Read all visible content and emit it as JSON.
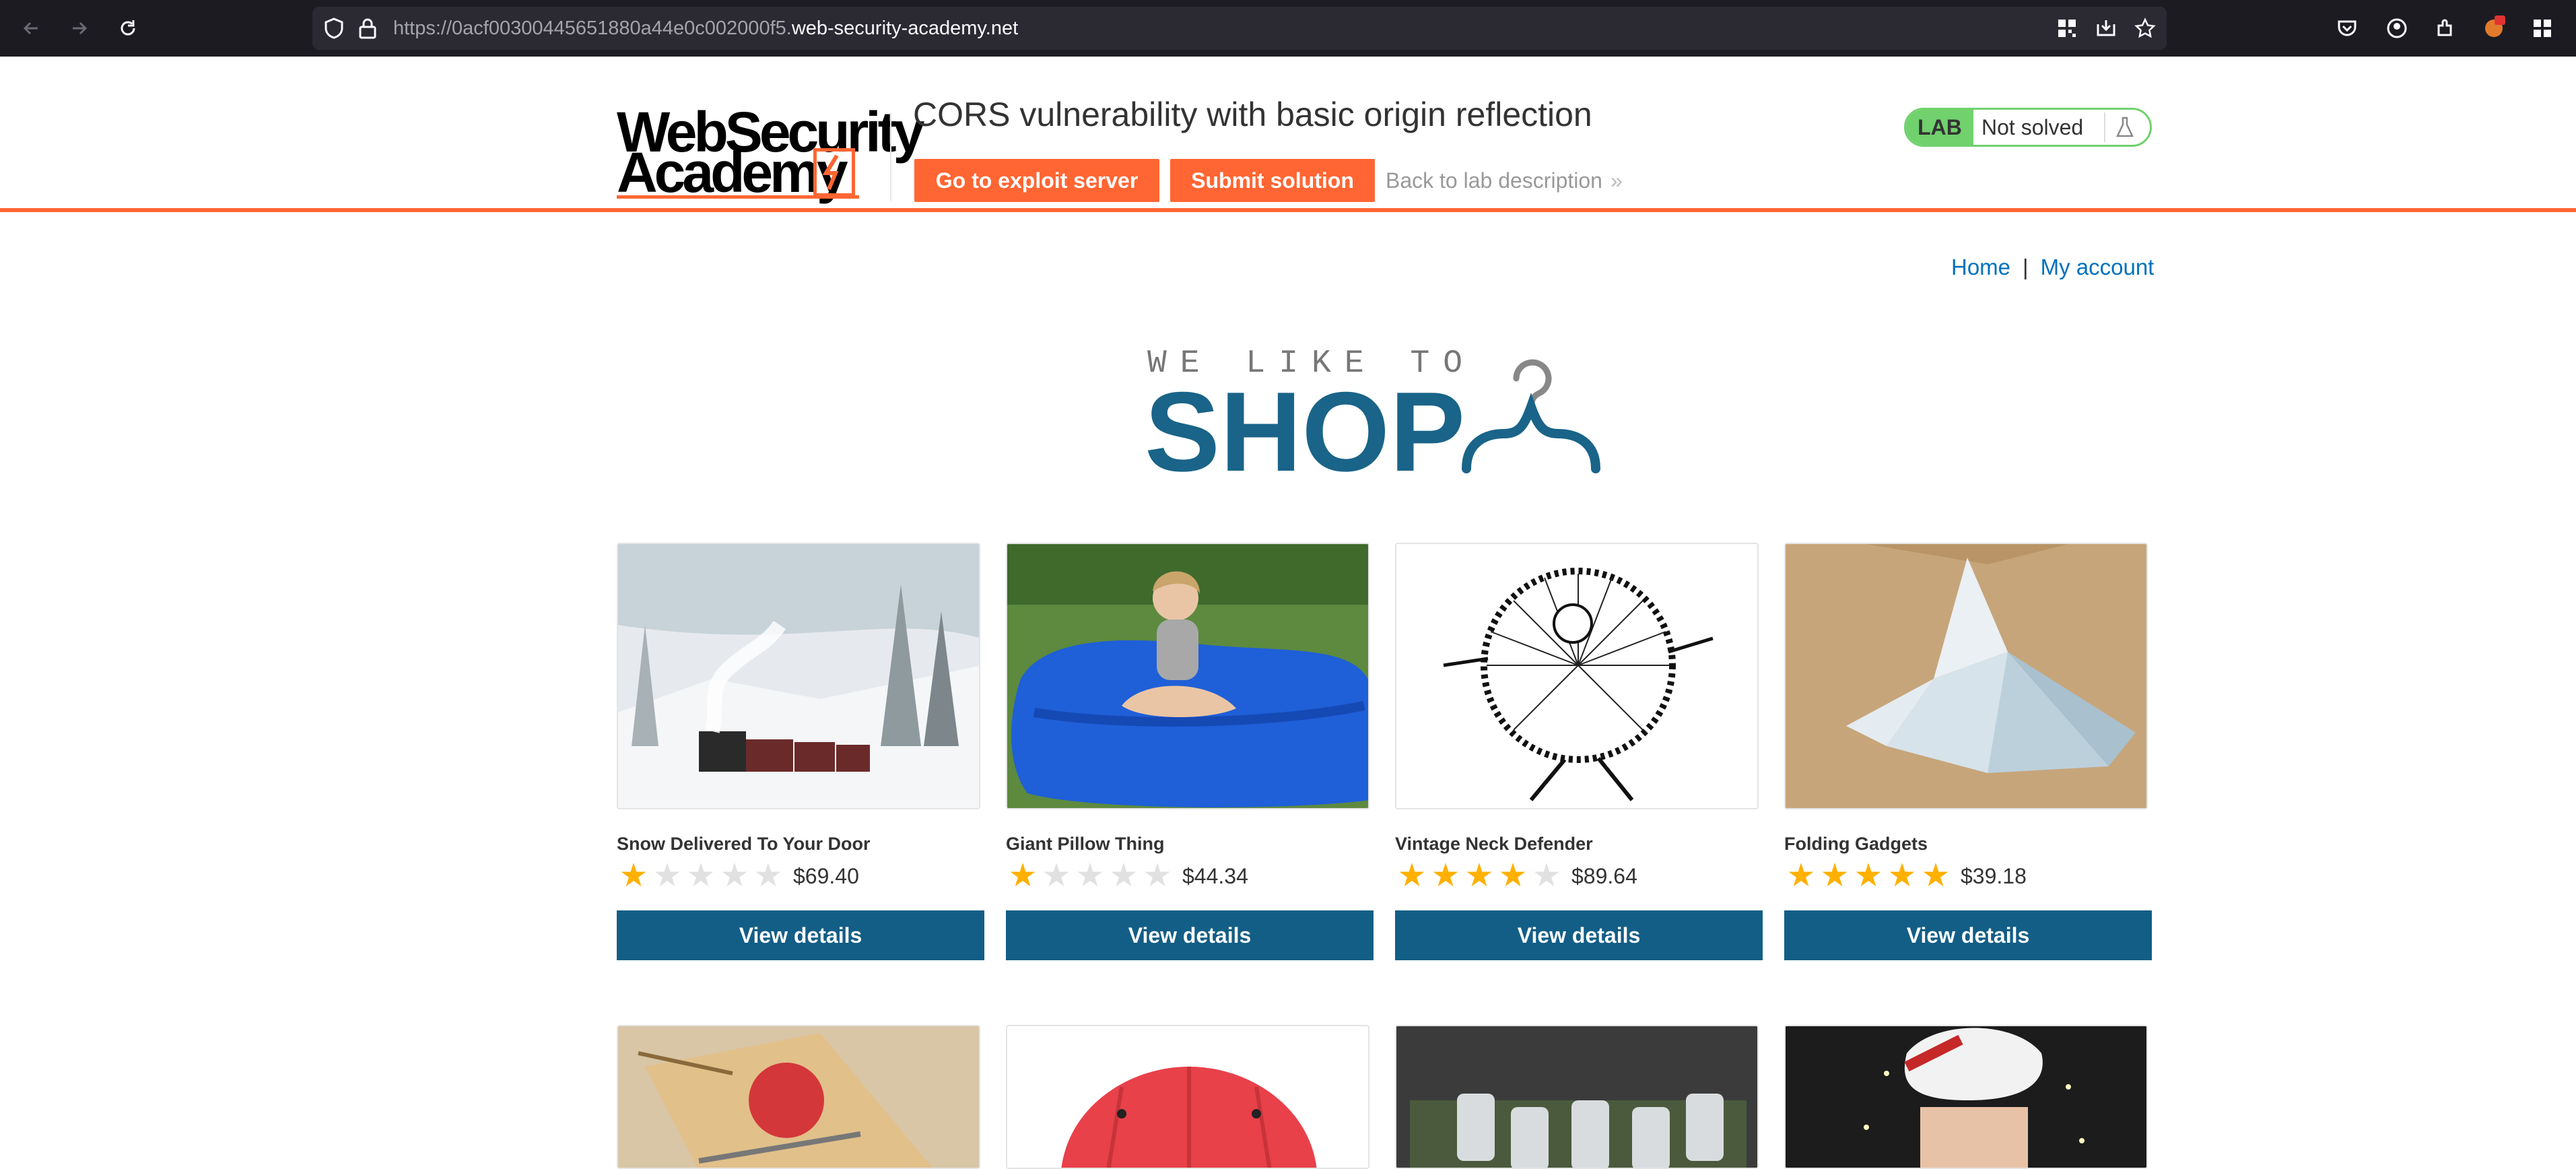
{
  "browser": {
    "url_prefix": "https://0acf00300445651880a44e0c002000f5.",
    "url_domain": "web-security-academy.net"
  },
  "lab": {
    "logo_line1": "WebSecurity",
    "logo_line2": "Academy",
    "title": "CORS vulnerability with basic origin reflection",
    "exploit_button": "Go to exploit server",
    "submit_button": "Submit solution",
    "back_link": "Back to lab description",
    "back_chevron": "»",
    "badge": "LAB",
    "status": "Not solved"
  },
  "nav": {
    "home": "Home",
    "separator": "|",
    "account": "My account"
  },
  "banner": {
    "subtitle": "WE LIKE TO",
    "title": "SHOP"
  },
  "products": [
    {
      "name": "Snow Delivered To Your Door",
      "rating": 1,
      "price": "$69.40",
      "button": "View details",
      "image": "snow-train-image"
    },
    {
      "name": "Giant Pillow Thing",
      "rating": 1,
      "price": "$44.34",
      "button": "View details",
      "image": "giant-pillow-image"
    },
    {
      "name": "Vintage Neck Defender",
      "rating": 4,
      "price": "$89.64",
      "button": "View details",
      "image": "neck-defender-image"
    },
    {
      "name": "Folding Gadgets",
      "rating": 5,
      "price": "$39.18",
      "button": "View details",
      "image": "folding-gadgets-image"
    }
  ],
  "colors": {
    "accent_orange": "#ff6633",
    "button_blue": "#135e86",
    "link_blue": "#0071bc",
    "star_gold": "#ffb000",
    "lab_green": "#70d16d"
  }
}
